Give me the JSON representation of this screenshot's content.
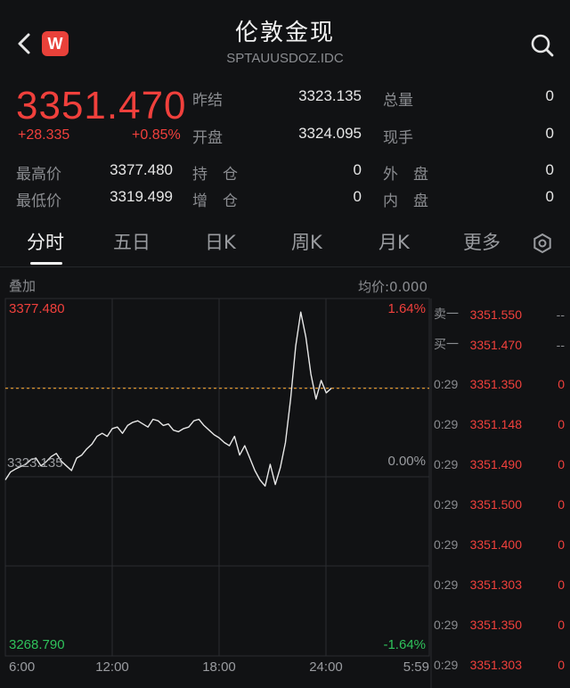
{
  "header": {
    "title": "伦敦金现",
    "subtitle": "SPTAUUSDOZ.IDC",
    "logo_letter": "W",
    "back_icon": "chevron-left-icon",
    "search_icon": "search-icon"
  },
  "quote": {
    "price": "3351.470",
    "change": "+28.335",
    "change_pct": "+0.85%",
    "stats": [
      {
        "label": "昨结",
        "value": "3323.135"
      },
      {
        "label": "总量",
        "value": "0"
      },
      {
        "label": "开盘",
        "value": "3324.095"
      },
      {
        "label": "现手",
        "value": "0"
      },
      {
        "label": "最高价",
        "value": "3377.480"
      },
      {
        "label": "持　仓",
        "value": "0"
      },
      {
        "label": "外　盘",
        "value": "0"
      },
      {
        "label": "最低价",
        "value": "3319.499"
      },
      {
        "label": "增　仓",
        "value": "0"
      },
      {
        "label": "内　盘",
        "value": "0"
      }
    ]
  },
  "tabs": [
    "分时",
    "五日",
    "日K",
    "周K",
    "月K",
    "更多"
  ],
  "settings_icon": "gear-icon",
  "chart_labels": {
    "overlay": "叠加",
    "avg_price": "均价:0.000",
    "y_high": "3377.480",
    "y_mid": "3323.135",
    "y_low": "3268.790",
    "pct_high": "1.64%",
    "pct_mid": "0.00%",
    "pct_low": "-1.64%",
    "x_ticks": [
      "6:00",
      "12:00",
      "18:00",
      "24:00",
      "5:59"
    ]
  },
  "chart_data": {
    "type": "line",
    "title": "",
    "xlabel": "",
    "ylabel": "",
    "x_range": [
      "6:00",
      "5:59"
    ],
    "ylim": [
      3268.79,
      3377.48
    ],
    "reference_line": 3323.135,
    "current_price_line": 3351.47,
    "series": [
      {
        "values": [
          3322.0,
          3324.5,
          3325.5,
          3326.3,
          3327.0,
          3328.5,
          3329.0,
          3326.5,
          3327.8,
          3329.5,
          3330.5,
          3328.0,
          3326.5,
          3325.0,
          3329.0,
          3330.0,
          3332.0,
          3333.5,
          3336.0,
          3337.0,
          3336.0,
          3338.5,
          3339.0,
          3337.0,
          3339.5,
          3340.5,
          3341.0,
          3340.0,
          3339.0,
          3341.5,
          3341.0,
          3339.5,
          3340.0,
          3338.0,
          3337.5,
          3338.5,
          3339.0,
          3341.0,
          3341.5,
          3339.5,
          3338.0,
          3336.5,
          3335.5,
          3334.0,
          3333.0,
          3336.0,
          3330.0,
          3333.0,
          3329.0,
          3325.0,
          3322.0,
          3320.0,
          3327.0,
          3320.5,
          3326.0,
          3334.0,
          3348.0,
          3365.0,
          3376.0,
          3368.0,
          3356.0,
          3348.0,
          3354.0,
          3350.0,
          3351.47
        ]
      }
    ]
  },
  "order_book": {
    "asks": [
      {
        "label": "卖一",
        "price": "3351.550",
        "vol": "--"
      }
    ],
    "bids": [
      {
        "label": "买一",
        "price": "3351.470",
        "vol": "--"
      }
    ],
    "trades": [
      {
        "time": "0:29",
        "price": "3351.350",
        "vol": "0"
      },
      {
        "time": "0:29",
        "price": "3351.148",
        "vol": "0"
      },
      {
        "time": "0:29",
        "price": "3351.490",
        "vol": "0"
      },
      {
        "time": "0:29",
        "price": "3351.500",
        "vol": "0"
      },
      {
        "time": "0:29",
        "price": "3351.400",
        "vol": "0"
      },
      {
        "time": "0:29",
        "price": "3351.303",
        "vol": "0"
      },
      {
        "time": "0:29",
        "price": "3351.350",
        "vol": "0"
      },
      {
        "time": "0:29",
        "price": "3351.303",
        "vol": "0"
      }
    ]
  },
  "colors": {
    "up": "#f0403c",
    "down": "#2fc25b",
    "accent_line": "#f0a030",
    "background": "#111214"
  }
}
